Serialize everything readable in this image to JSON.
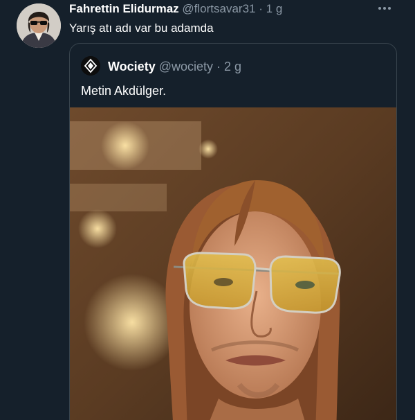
{
  "tweet": {
    "author_name": "Fahrettin Elidurmaz",
    "author_handle": "@flortsavar31",
    "separator": "·",
    "timestamp": "1 g",
    "text": "Yarış atı adı var bu adamda",
    "more_icon": "more-dots-icon"
  },
  "quoted_tweet": {
    "author_name": "Wociety",
    "author_handle": "@wociety",
    "separator": "·",
    "timestamp": "2 g",
    "text": "Metin Akdülger.",
    "logo_icon": "wociety-logo-icon"
  },
  "colors": {
    "background": "#15202b",
    "text_primary": "#ffffff",
    "text_secondary": "#8b98a5",
    "border": "#38444d"
  }
}
